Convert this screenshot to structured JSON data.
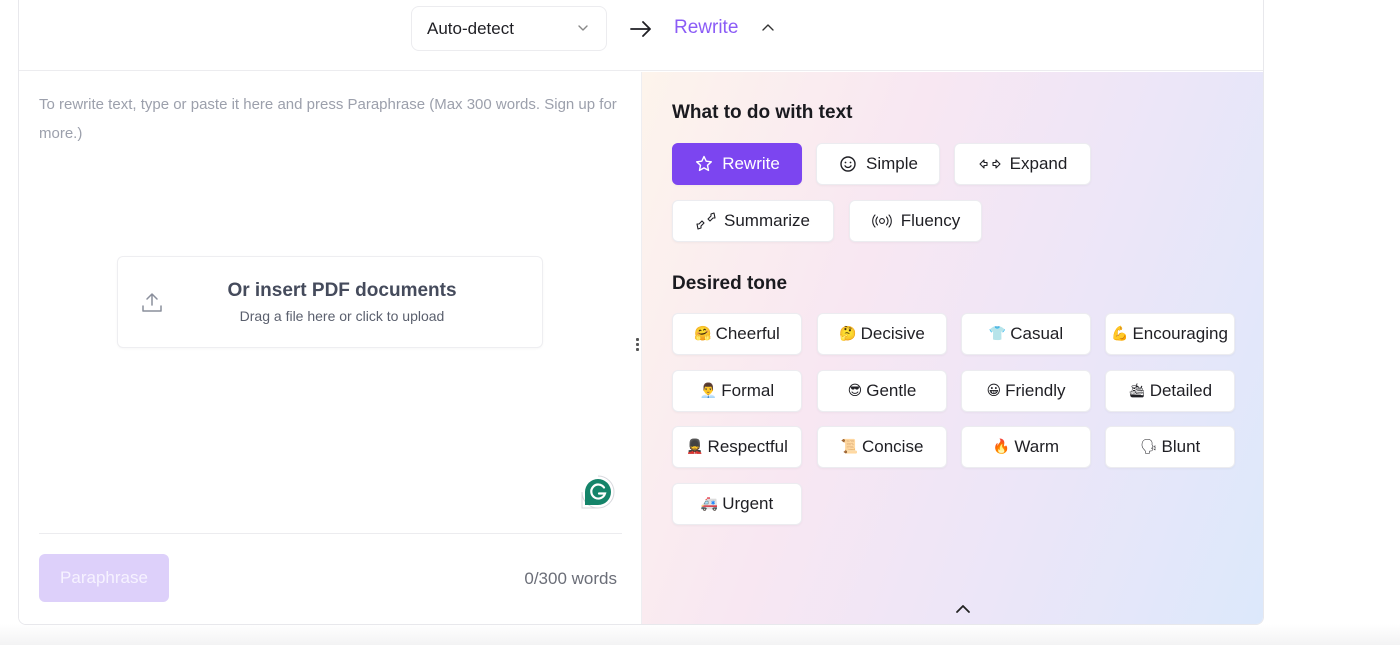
{
  "header": {
    "source_language": "Auto-detect",
    "mode_label": "Rewrite"
  },
  "input": {
    "placeholder": "To rewrite text, type or paste it here and press Paraphrase (Max 300 words. Sign up for more.)",
    "upload_title": "Or insert PDF documents",
    "upload_subtitle": "Drag a file here or click to upload",
    "paraphrase_label": "Paraphrase",
    "word_count": "0/300 words"
  },
  "options": {
    "actions_title": "What to do with text",
    "actions": [
      {
        "label": "Rewrite",
        "icon": "star-icon",
        "active": true
      },
      {
        "label": "Simple",
        "icon": "smiley-icon",
        "active": false
      },
      {
        "label": "Expand",
        "icon": "expand-arrows-icon",
        "active": false
      },
      {
        "label": "Summarize",
        "icon": "collapse-arrows-icon",
        "active": false
      },
      {
        "label": "Fluency",
        "icon": "broadcast-icon",
        "active": false
      }
    ],
    "tone_title": "Desired tone",
    "tones": [
      {
        "label": "Cheerful",
        "emoji": "🤗"
      },
      {
        "label": "Decisive",
        "emoji": "🤔"
      },
      {
        "label": "Casual",
        "emoji": "👕"
      },
      {
        "label": "Encouraging",
        "emoji": "💪"
      },
      {
        "label": "Formal",
        "emoji": "👨‍💼"
      },
      {
        "label": "Gentle",
        "emoji": "😎"
      },
      {
        "label": "Friendly",
        "emoji": "😀"
      },
      {
        "label": "Detailed",
        "emoji": "🛳"
      },
      {
        "label": "Respectful",
        "emoji": "💂"
      },
      {
        "label": "Concise",
        "emoji": "📜"
      },
      {
        "label": "Warm",
        "emoji": "🔥"
      },
      {
        "label": "Blunt",
        "emoji": "🗣"
      },
      {
        "label": "Urgent",
        "emoji": "🚑"
      }
    ]
  },
  "colors": {
    "accent": "#7c45f0",
    "accent_text": "#8b5cf6",
    "disabled_button": "#ddd0fa"
  }
}
